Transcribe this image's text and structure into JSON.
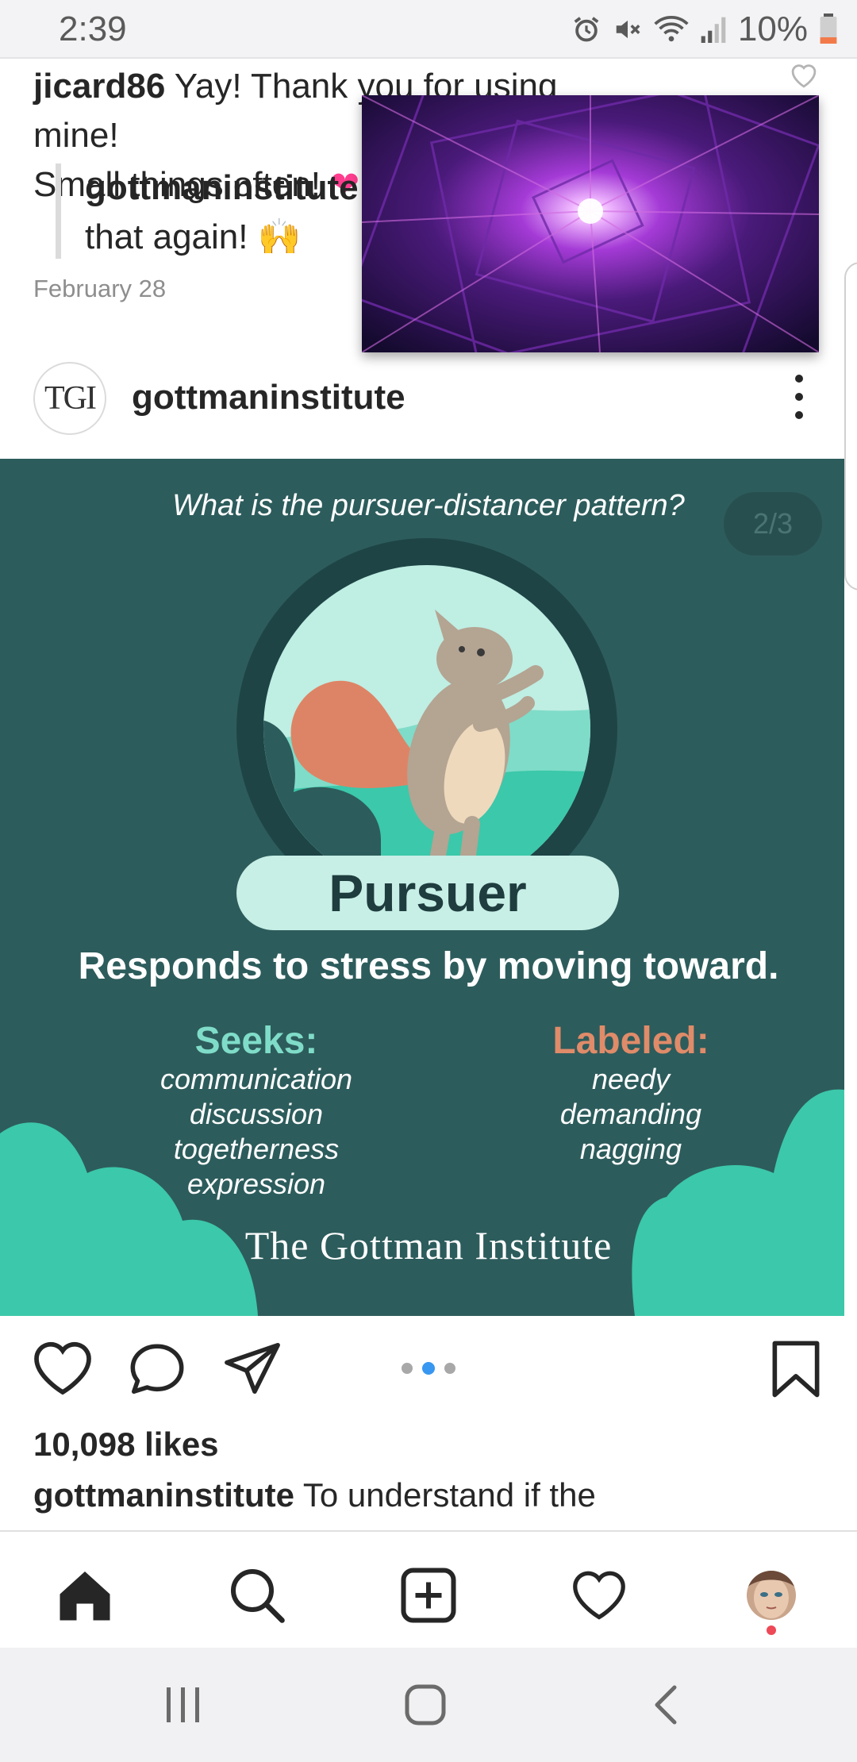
{
  "status_bar": {
    "time": "2:39",
    "battery": "10%"
  },
  "comment": {
    "username": "jicard86",
    "text": "Yay! Thank you for using mine!",
    "text_line2": "Small things often!",
    "reply_username": "gottmaninstitute",
    "reply_text": "that again! 🙌",
    "date": "February 28"
  },
  "post": {
    "avatar_text": "TGI",
    "username": "gottmaninstitute",
    "image": {
      "question": "What is the pursuer-distancer pattern?",
      "page_indicator": "2/3",
      "title": "Pursuer",
      "tagline": "Responds to stress by moving toward.",
      "seeks_title": "Seeks:",
      "seeks": [
        "communication",
        "discussion",
        "togetherness",
        "expression"
      ],
      "labeled_title": "Labeled:",
      "labeled": [
        "needy",
        "demanding",
        "nagging"
      ],
      "credit": "The Gottman Institute",
      "colors": {
        "background": "#2d5c5c",
        "mint": "#7fdcc8",
        "orange": "#e08b69",
        "hill": "#3cc8aa"
      }
    },
    "carousel": {
      "count": 3,
      "active_index": 1
    },
    "likes": "10,098 likes",
    "caption_username": "gottmaninstitute",
    "caption_text": "To understand if the"
  },
  "icons": {
    "action_bar": [
      "heart-icon",
      "comment-icon",
      "share-icon",
      "bookmark-icon"
    ],
    "bottom_nav": [
      "home-icon",
      "search-icon",
      "add-post-icon",
      "activity-heart-icon",
      "profile-avatar"
    ],
    "system_nav": [
      "recents-icon",
      "home-square-icon",
      "back-icon"
    ]
  }
}
